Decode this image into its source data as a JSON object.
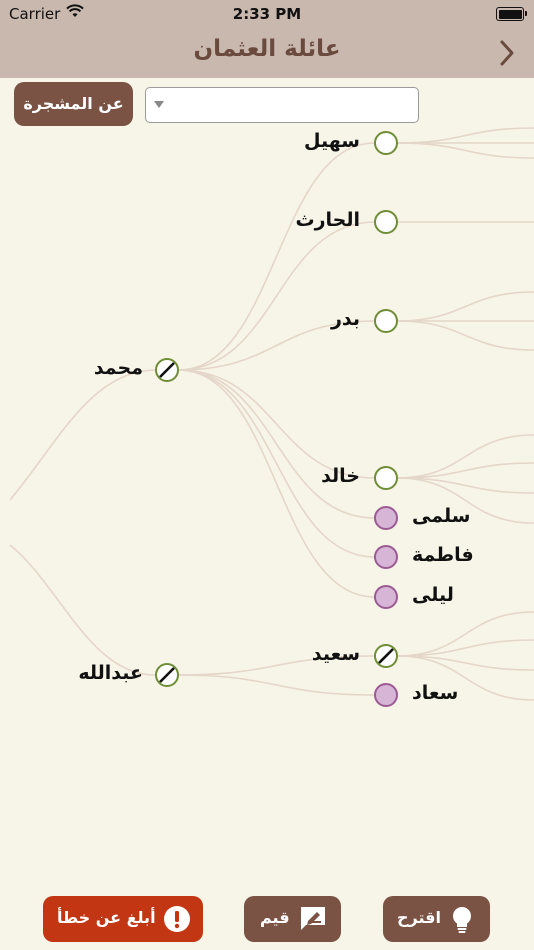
{
  "status_bar": {
    "carrier": "Carrier",
    "time": "2:33 PM"
  },
  "nav": {
    "title": "عائلة العثمان"
  },
  "about_button": {
    "label": "عن المشجرة"
  },
  "selector": {
    "value": ""
  },
  "tree": {
    "root_children": [
      {
        "name": "محمد",
        "gender": "male",
        "deceased": true,
        "children": [
          {
            "name": "سهيل",
            "gender": "male"
          },
          {
            "name": "الحارث",
            "gender": "male"
          },
          {
            "name": "بدر",
            "gender": "male"
          },
          {
            "name": "خالد",
            "gender": "male"
          },
          {
            "name": "سلمى",
            "gender": "female"
          },
          {
            "name": "فاطمة",
            "gender": "female"
          },
          {
            "name": "ليلى",
            "gender": "female"
          }
        ]
      },
      {
        "name": "عبدالله",
        "gender": "male",
        "deceased": true,
        "children": [
          {
            "name": "سعيد",
            "gender": "male",
            "deceased": true
          },
          {
            "name": "سعاد",
            "gender": "female"
          }
        ]
      }
    ]
  },
  "bottom_bar": {
    "report": "أبلغ عن خطأ",
    "rate": "قيم",
    "suggest": "اقترح"
  },
  "colors": {
    "header": "#c8b8ae",
    "title": "#6b4a3e",
    "background": "#f7f5e7",
    "button_brown": "#7a5345",
    "report_red": "#c23614",
    "male_ring": "#6e8d34",
    "female_fill": "#d6b5d6",
    "female_ring": "#9b5a93",
    "branch": "#e4d6c9"
  },
  "icons": {
    "back": "chevron-left-icon",
    "select_arrow": "caret-down-icon",
    "report": "exclamation-circle-icon",
    "rate": "pencil-square-icon",
    "suggest": "lightbulb-icon",
    "deceased_marker": "slash-circle-icon"
  }
}
